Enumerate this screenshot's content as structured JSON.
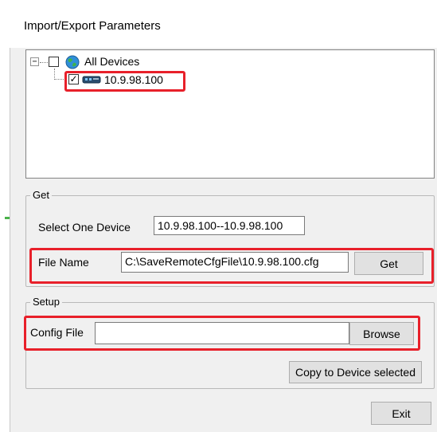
{
  "window": {
    "title": "Import/Export Parameters"
  },
  "tree": {
    "root": {
      "label": "All Devices",
      "expander": "−",
      "checked": false,
      "icon": "globe-icon"
    },
    "children": [
      {
        "label": "10.9.98.100",
        "checked": true,
        "check_glyph": "✓",
        "icon": "network-device-icon"
      }
    ]
  },
  "get_group": {
    "legend": "Get",
    "select_device_label": "Select One Device",
    "select_device_value": "10.9.98.100--10.9.98.100",
    "file_name_label": "File Name",
    "file_name_value": "C:\\SaveRemoteCfgFile\\10.9.98.100.cfg",
    "get_button": "Get"
  },
  "setup_group": {
    "legend": "Setup",
    "config_file_label": "Config File",
    "config_file_value": "",
    "browse_button": "Browse",
    "copy_button": "Copy to Device selected"
  },
  "exit_button": "Exit",
  "colors": {
    "highlight": "#e8202a",
    "window_bg": "#f0f0f0",
    "accent_left": "#49b249"
  }
}
